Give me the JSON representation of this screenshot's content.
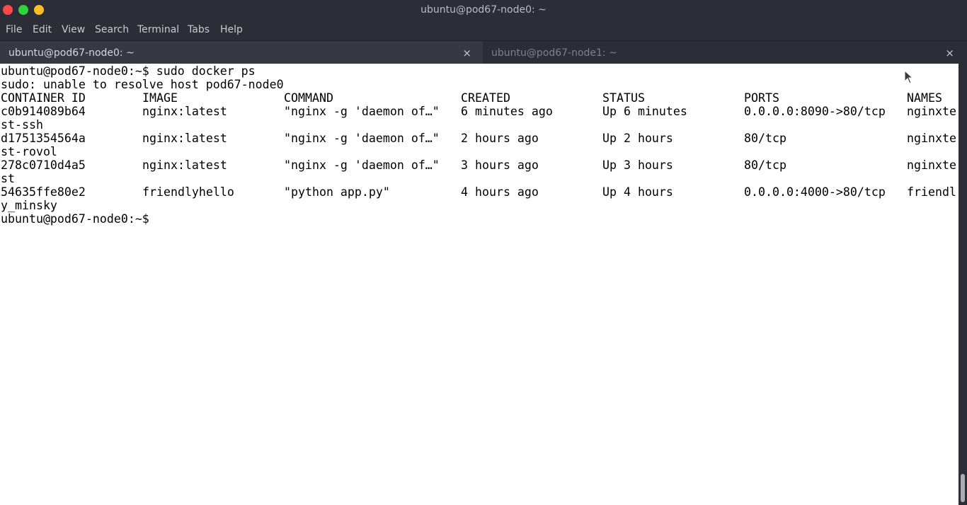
{
  "window": {
    "title": "ubuntu@pod67-node0: ~"
  },
  "menu": {
    "items": [
      "File",
      "Edit",
      "View",
      "Search",
      "Terminal",
      "Tabs",
      "Help"
    ]
  },
  "tabs": [
    {
      "label": "ubuntu@pod67-node0: ~",
      "close": "×"
    },
    {
      "label": "ubuntu@pod67-node1: ~",
      "close": "×"
    }
  ],
  "terminal": {
    "command_line": "ubuntu@pod67-node0:~$ sudo docker ps",
    "warning": "sudo: unable to resolve host pod67-node0",
    "headers": [
      "CONTAINER ID",
      "IMAGE",
      "COMMAND",
      "CREATED",
      "STATUS",
      "PORTS",
      "NAMES"
    ],
    "rows": [
      {
        "cells": [
          "c0b914089b64",
          "nginx:latest",
          "\"nginx -g 'daemon of…\"",
          "6 minutes ago",
          "Up 6 minutes",
          "0.0.0.0:8090->80/tcp",
          "nginxte"
        ],
        "wrap": "st-ssh"
      },
      {
        "cells": [
          "d1751354564a",
          "nginx:latest",
          "\"nginx -g 'daemon of…\"",
          "2 hours ago",
          "Up 2 hours",
          "80/tcp",
          "nginxte"
        ],
        "wrap": "st-rovol"
      },
      {
        "cells": [
          "278c0710d4a5",
          "nginx:latest",
          "\"nginx -g 'daemon of…\"",
          "3 hours ago",
          "Up 3 hours",
          "80/tcp",
          "nginxte"
        ],
        "wrap": "st"
      },
      {
        "cells": [
          "54635ffe80e2",
          "friendlyhello",
          "\"python app.py\"",
          "4 hours ago",
          "Up 4 hours",
          "0.0.0.0:4000->80/tcp",
          "friendl"
        ],
        "wrap": "y_minsky"
      }
    ],
    "prompt": "ubuntu@pod67-node0:~$"
  }
}
